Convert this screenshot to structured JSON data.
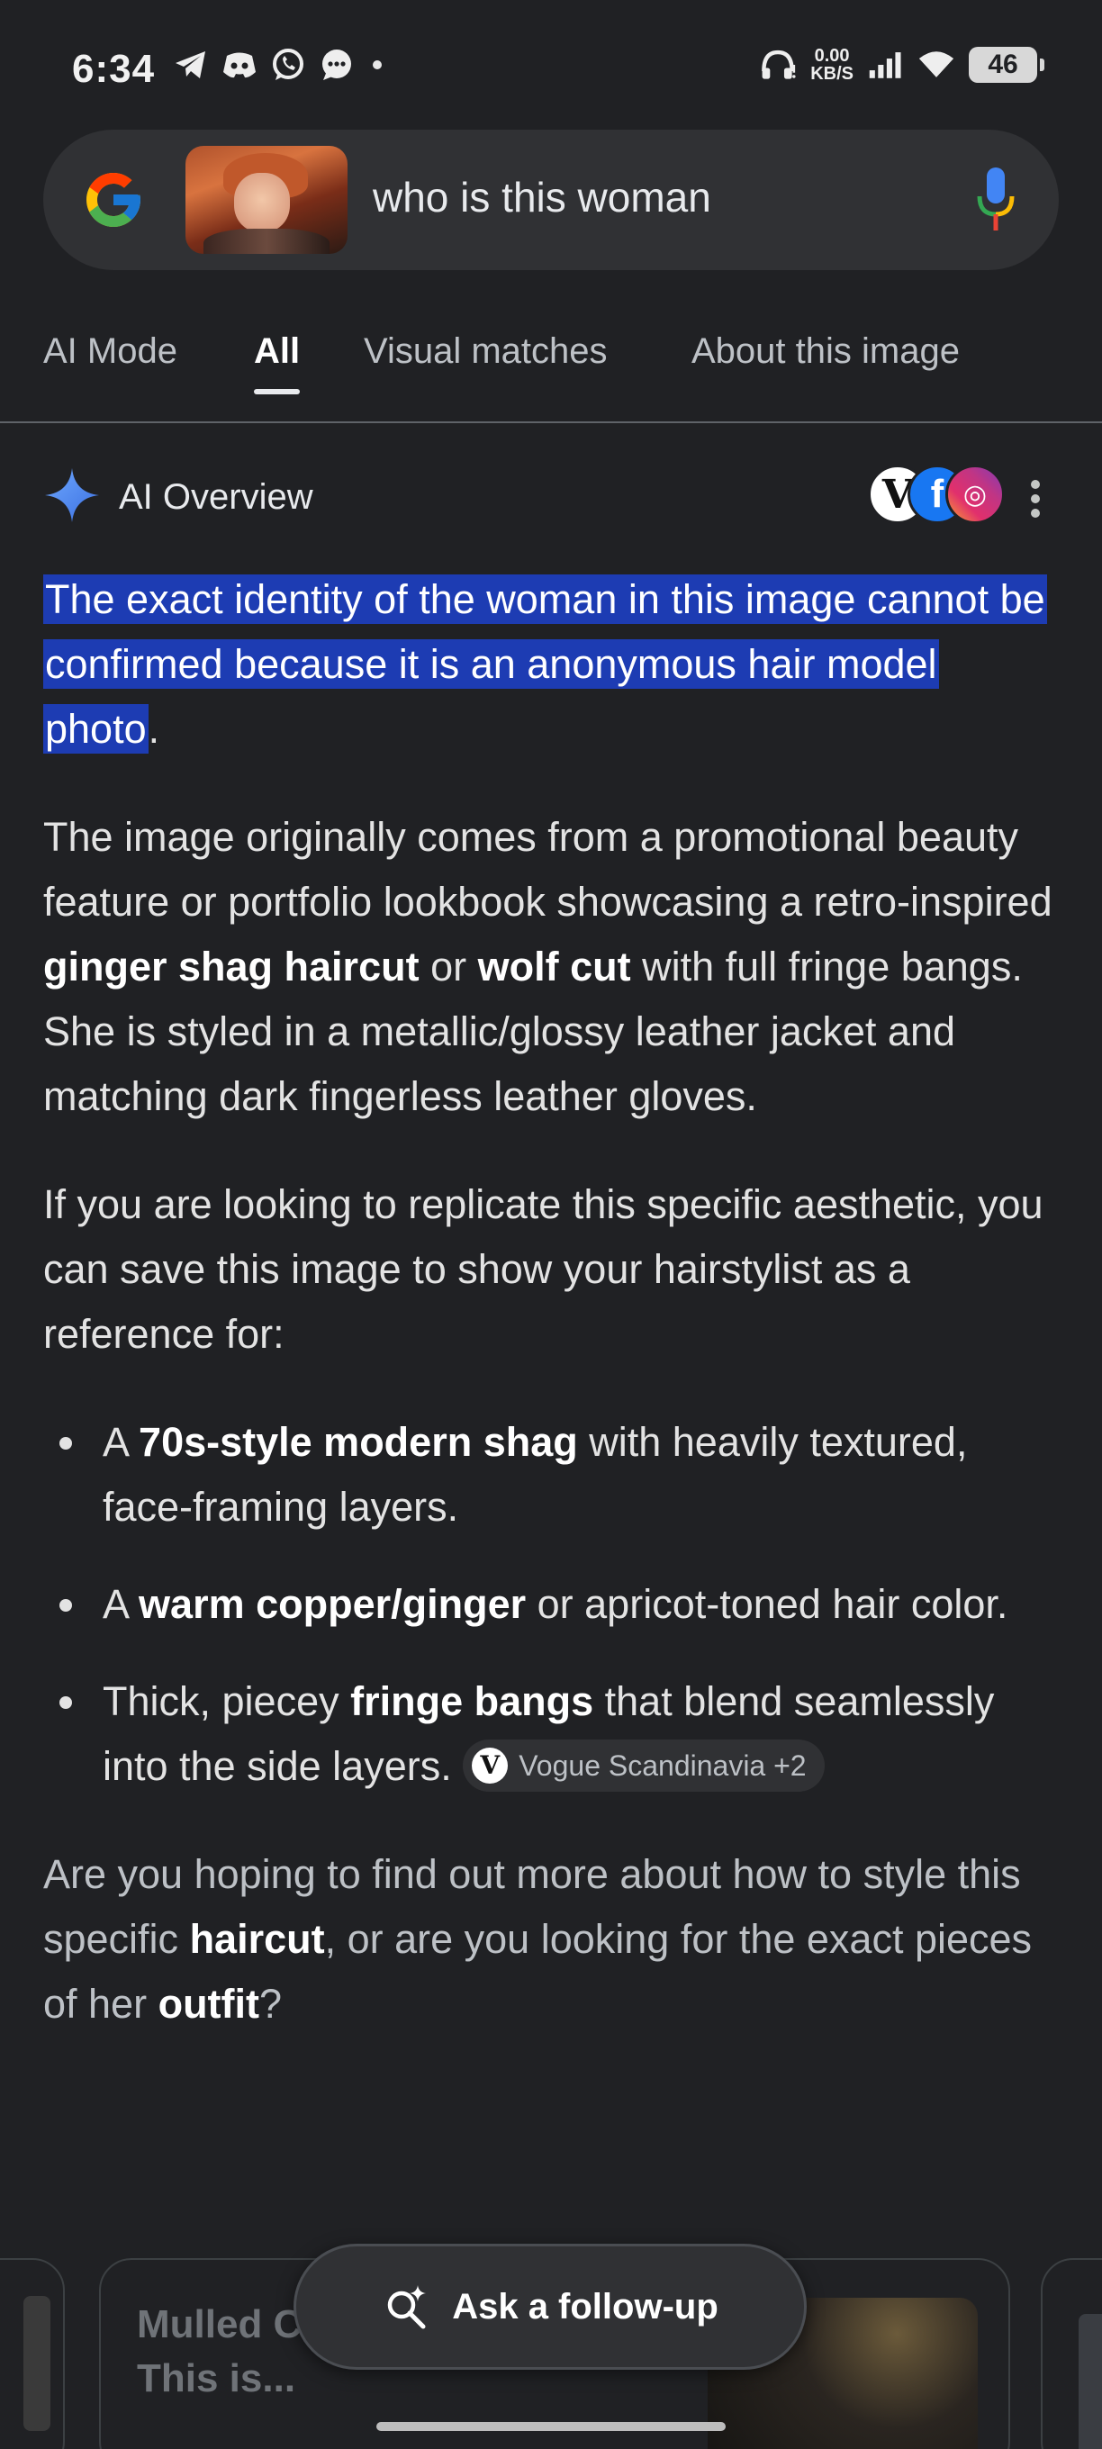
{
  "status_bar": {
    "time": "6:34",
    "net_speed_value": "0.00",
    "net_speed_unit": "KB/S",
    "battery": "46",
    "left_icons": [
      "telegram-icon",
      "discord-icon",
      "whatsapp-icon",
      "messages-icon",
      "dot-icon"
    ],
    "right_icons": [
      "headphones-icon",
      "signal-icon",
      "wifi-icon",
      "battery-icon"
    ]
  },
  "search": {
    "query": "who is this woman",
    "icons": [
      "google-logo",
      "image-thumbnail",
      "mic-icon"
    ]
  },
  "tabs": [
    {
      "label": "AI Mode",
      "active": false
    },
    {
      "label": "All",
      "active": true
    },
    {
      "label": "Visual matches",
      "active": false
    },
    {
      "label": "About this image",
      "active": false
    }
  ],
  "ai_overview": {
    "title": "AI Overview",
    "source_icons": {
      "v": "V",
      "f": "f",
      "i": "◎"
    },
    "highlight": "The exact identity of the woman in this image cannot be confirmed because it is an anonymous hair model photo",
    "highlight_end": ".",
    "p2": {
      "a": "The image originally comes from a promotional beauty feature or portfolio lookbook showcasing a retro-inspired ",
      "b1": "ginger shag haircut",
      "c": " or ",
      "b2": "wolf cut",
      "d": " with full fringe bangs. She is styled in a metallic/glossy leather jacket and matching dark fingerless leather gloves."
    },
    "p3": "If you are looking to replicate this specific aesthetic, you can save this image to show your hairstylist as a reference for:",
    "bullets": [
      {
        "pre": "A ",
        "bold": "70s-style modern shag",
        "post": " with heavily textured, face-framing layers."
      },
      {
        "pre": "A ",
        "bold": "warm copper/ginger",
        "post": " or apricot-toned hair color."
      },
      {
        "pre": "Thick, piecey ",
        "bold": "fringe bangs",
        "post": " that blend seamlessly into the side layers. "
      }
    ],
    "citation_chip": {
      "logo": "V",
      "label": "Vogue Scandinavia +2"
    },
    "p4": {
      "a": "Are you hoping to find out more about how to style this specific ",
      "b1": "haircut",
      "c": ", or are you looking for the exact pieces of her ",
      "b2": "outfit",
      "d": "?"
    }
  },
  "cards": {
    "main_title": "Mulled C... Apricot Ribbons This is..."
  },
  "followup": {
    "label": "Ask a follow-up"
  },
  "colors": {
    "background": "#202124",
    "highlight": "#1d3cb3",
    "search_bg": "#303134"
  }
}
